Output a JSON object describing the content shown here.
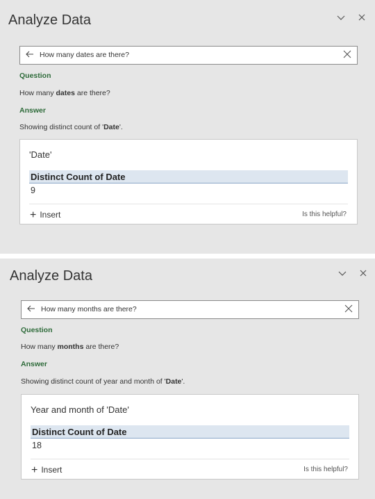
{
  "panels": [
    {
      "title": "Analyze Data",
      "query": "How many dates are there?",
      "question_label": "Question",
      "question_pre": "How many ",
      "question_bold": "dates",
      "question_post": " are there?",
      "answer_label": "Answer",
      "answer_pre": "Showing distinct count of '",
      "answer_bold": "Date",
      "answer_post": "'.",
      "card_title": "'Date'",
      "column_header": "Distinct Count of Date",
      "value": "9",
      "insert_label": "Insert",
      "helpful_label": "Is this helpful?"
    },
    {
      "title": "Analyze Data",
      "query": "How many months are there?",
      "question_label": "Question",
      "question_pre": "How many ",
      "question_bold": "months",
      "question_post": " are there?",
      "answer_label": "Answer",
      "answer_pre": "Showing distinct count of year and month of '",
      "answer_bold": "Date",
      "answer_post": "'.",
      "card_title": "Year and month of 'Date'",
      "column_header": "Distinct Count of Date",
      "value": "18",
      "insert_label": "Insert",
      "helpful_label": "Is this helpful?"
    }
  ],
  "icons": {
    "chevron": "chevron-down-icon",
    "close": "close-icon",
    "back": "back-arrow-icon",
    "clear": "clear-icon",
    "plus": "plus-icon"
  },
  "colors": {
    "panel_bg": "#e6e6e6",
    "label_green": "#2e6b3a",
    "table_header_bg": "#dde6f0"
  }
}
